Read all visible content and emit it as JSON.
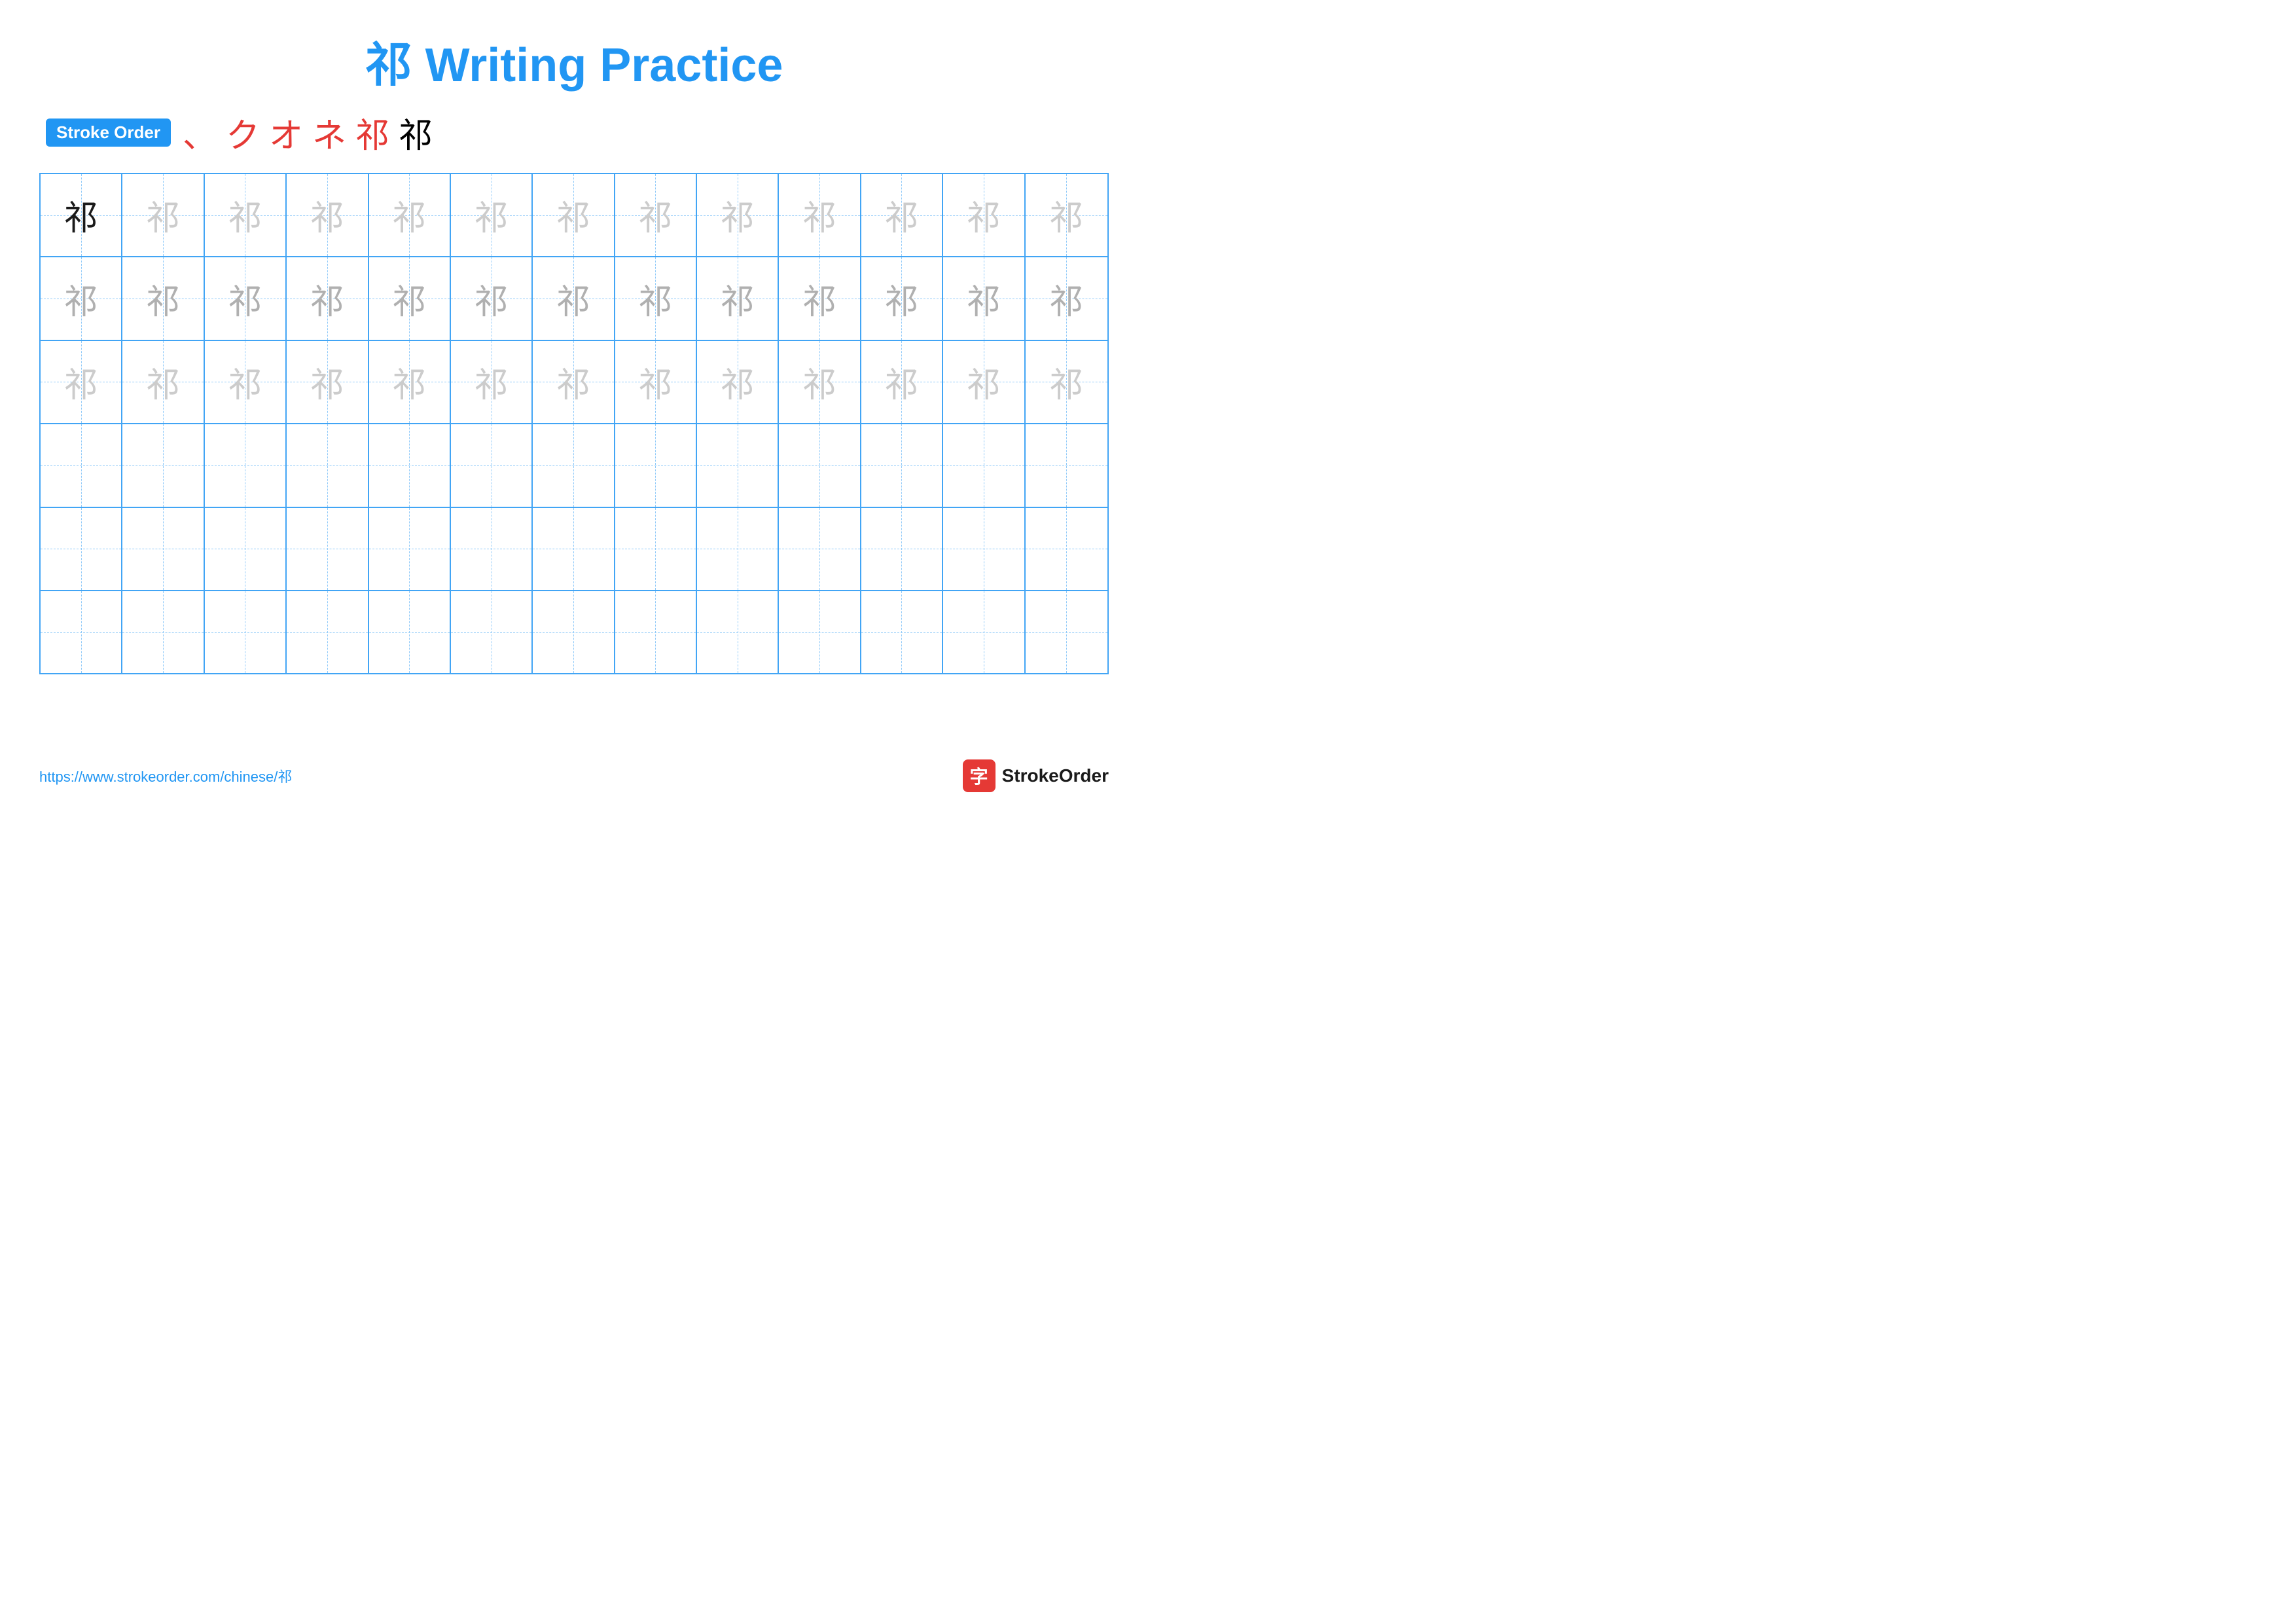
{
  "title": {
    "char": "祁",
    "label": "Writing Practice",
    "full": "祁 Writing Practice"
  },
  "stroke_order": {
    "badge_label": "Stroke Order",
    "strokes": [
      "、",
      "ク",
      "オ",
      "ネ",
      "祁",
      "祁"
    ]
  },
  "grid": {
    "rows": 6,
    "cols": 13,
    "char": "祁",
    "row1_first_dark": true
  },
  "footer": {
    "url": "https://www.strokeorder.com/chinese/祁",
    "logo_char": "字",
    "logo_text": "StrokeOrder"
  }
}
